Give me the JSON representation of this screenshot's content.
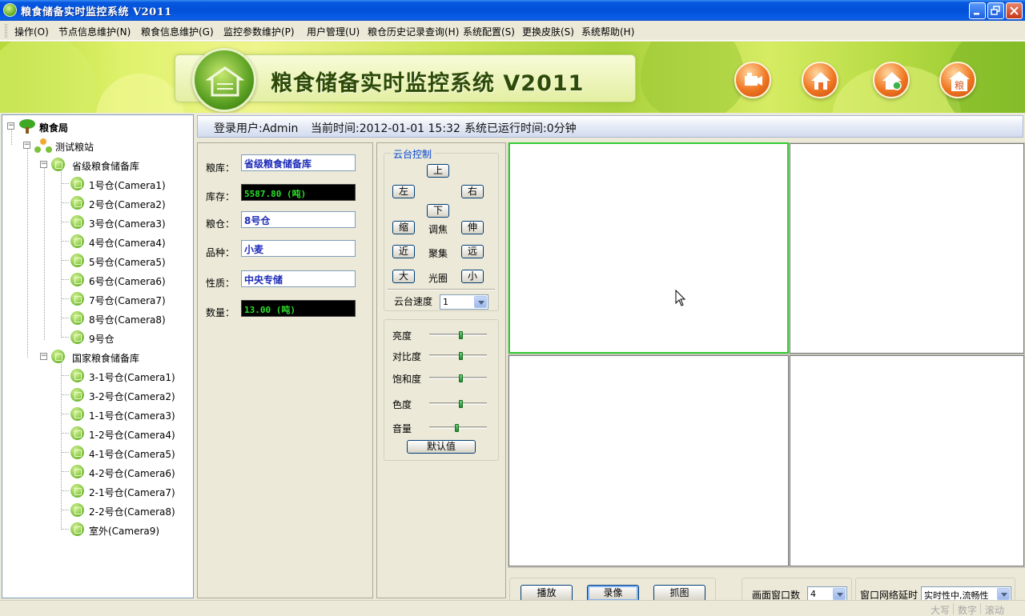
{
  "window": {
    "title": "粮食储备实时监控系统 V2011"
  },
  "menu": [
    "操作(O)",
    "节点信息维护(N)",
    "粮食信息维护(G)",
    "监控参数维护(P)",
    "用户管理(U)",
    "粮仓历史记录查询(H)",
    "系统配置(S)",
    "更换皮肤(S)",
    "系统帮助(H)"
  ],
  "banner": {
    "title": "粮食储备实时监控系统  V2011",
    "orb4_char": "粮"
  },
  "tree": {
    "root": "粮食局",
    "station": "测试粮站",
    "depot1": {
      "name": "省级粮食储备库",
      "items": [
        "1号仓(Camera1)",
        "2号仓(Camera2)",
        "3号仓(Camera3)",
        "4号仓(Camera4)",
        "5号仓(Camera5)",
        "6号仓(Camera6)",
        "7号仓(Camera7)",
        "8号仓(Camera8)",
        "9号仓"
      ]
    },
    "depot2": {
      "name": "国家粮食储备库",
      "items": [
        "3-1号仓(Camera1)",
        "3-2号仓(Camera2)",
        "1-1号仓(Camera3)",
        "1-2号仓(Camera4)",
        "4-1号仓(Camera5)",
        "4-2号仓(Camera6)",
        "2-1号仓(Camera7)",
        "2-2号仓(Camera8)",
        "室外(Camera9)"
      ]
    }
  },
  "infobar": {
    "user": "登录用户:Admin",
    "time": "当前时间:2012-01-01 15:32",
    "uptime": "系统已运行时间:0分钟"
  },
  "info": {
    "depot_label": "粮库：",
    "depot_value": "省级粮食储备库",
    "stock_label": "库存：",
    "stock_value": "5587.80 (吨)",
    "bin_label": "粮仓：",
    "bin_value": "8号仓",
    "variety_label": "品种：",
    "variety_value": "小麦",
    "nature_label": "性质：",
    "nature_value": "中央专储",
    "qty_label": "数量：",
    "qty_value": "13.00 (吨)"
  },
  "ptz": {
    "group_title": "云台控制",
    "up": "上",
    "left": "左",
    "right": "右",
    "down": "下",
    "shrink": "缩",
    "zoom_label": "调焦",
    "stretch": "伸",
    "near": "近",
    "focus_label": "聚集",
    "far": "远",
    "big": "大",
    "iris_label": "光圈",
    "small": "小",
    "speed_label": "云台速度",
    "speed_value": "1"
  },
  "image": {
    "brightness_label": "亮度",
    "brightness": 0.55,
    "contrast_label": "对比度",
    "contrast": 0.55,
    "saturation_label": "饱和度",
    "saturation": 0.55,
    "hue_label": "色度",
    "hue": 0.55,
    "volume_label": "音量",
    "volume": 0.48,
    "default_button": "默认值"
  },
  "bottom": {
    "play": "播放",
    "record": "录像",
    "capture": "抓图",
    "window_count_label": "画面窗口数",
    "window_count_value": "4",
    "latency_label": "窗口网络延时",
    "latency_value": "实时性中,流畅性"
  },
  "status": {
    "caps": "大写",
    "num": "数字",
    "scroll": "滚动"
  },
  "colors": {
    "title_blue": "#0350d8",
    "value_blue": "#1d2bb8",
    "led_green": "#2ae02a",
    "active_green": "#33cc33"
  }
}
